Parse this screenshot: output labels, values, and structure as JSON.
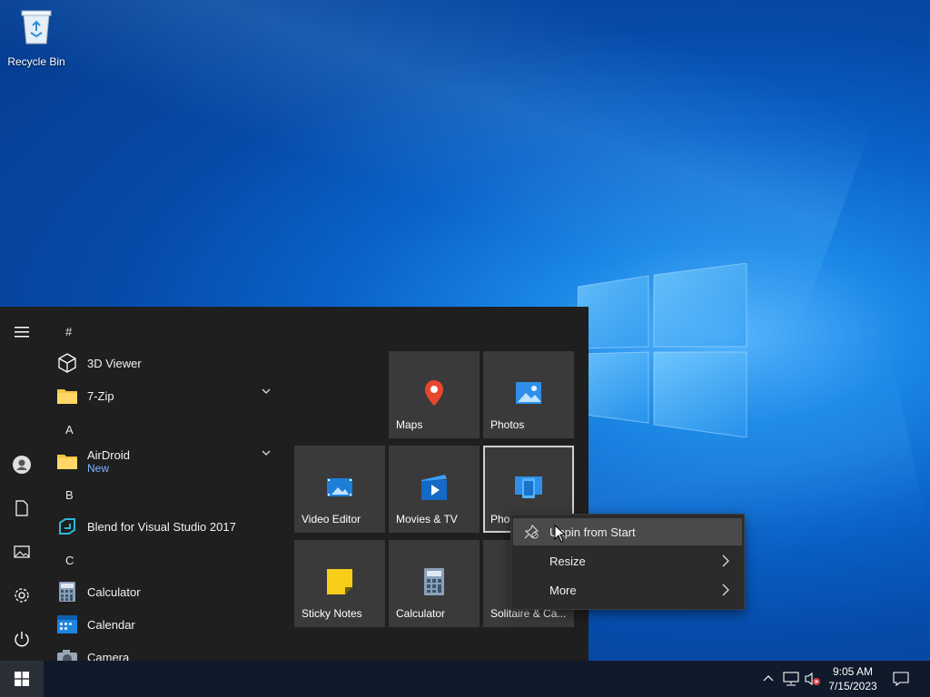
{
  "desktop": {
    "icons": [
      {
        "label": "Recycle Bin",
        "icon": "recycle-bin-icon"
      }
    ],
    "accent_color": "#0a63c9"
  },
  "start_menu": {
    "rail": [
      "hamburger-menu-icon",
      "user-icon",
      "document-icon",
      "pictures-icon",
      "settings-icon",
      "power-icon"
    ],
    "app_list": [
      {
        "type": "letter",
        "text": "#"
      },
      {
        "type": "app",
        "name": "3D Viewer",
        "icon": "cube-icon"
      },
      {
        "type": "app",
        "name": "7-Zip",
        "icon": "folder-icon",
        "expandable": true
      },
      {
        "type": "letter",
        "text": "A"
      },
      {
        "type": "app",
        "name": "AirDroid",
        "badge": "New",
        "icon": "folder-icon",
        "expandable": true
      },
      {
        "type": "letter",
        "text": "B"
      },
      {
        "type": "app",
        "name": "Blend for Visual Studio 2017",
        "icon": "blend-icon"
      },
      {
        "type": "letter",
        "text": "C"
      },
      {
        "type": "app",
        "name": "Calculator",
        "icon": "calculator-icon"
      },
      {
        "type": "app",
        "name": "Calendar",
        "icon": "calendar-icon"
      },
      {
        "type": "app",
        "name": "Camera",
        "icon": "camera-icon"
      }
    ],
    "tiles": [
      {
        "name": "Maps",
        "icon": "map-pin-icon"
      },
      {
        "name": "Photos",
        "icon": "photos-icon"
      },
      {
        "name": "Video Editor",
        "icon": "video-editor-icon"
      },
      {
        "name": "Movies & TV",
        "icon": "movies-tv-icon"
      },
      {
        "name": "Pho",
        "icon": "phone-icon"
      },
      {
        "name": "Sticky Notes",
        "icon": "sticky-notes-icon"
      },
      {
        "name": "Calculator",
        "icon": "calculator-icon"
      },
      {
        "name": "Solitaire & Ca...",
        "icon": "solitaire-icon"
      }
    ]
  },
  "context_menu": {
    "items": [
      {
        "label": "Unpin from Start",
        "icon": "unpin-icon",
        "highlighted": true
      },
      {
        "label": "Resize",
        "submenu": true
      },
      {
        "label": "More",
        "submenu": true
      }
    ]
  },
  "taskbar": {
    "start_icon": "windows-logo-icon",
    "tray_icons": [
      "chevron-up-icon",
      "network-icon",
      "volume-muted-icon",
      "notification-icon"
    ],
    "time": "9:05 AM",
    "date": "7/15/2023"
  }
}
